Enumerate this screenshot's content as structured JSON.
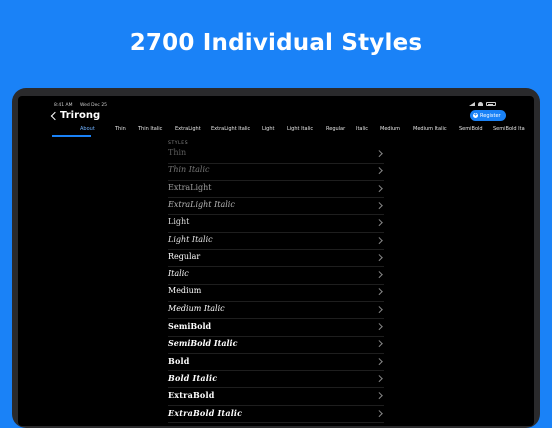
{
  "headline": "2700 Individual Styles",
  "status": {
    "time": "8:41 AM",
    "date": "Wed Dec 25"
  },
  "nav": {
    "title": "Trirong"
  },
  "register": {
    "label": "Register"
  },
  "tabs": [
    "About",
    "Thin",
    "Thin Italic",
    "ExtraLight",
    "ExtraLight Italic",
    "Light",
    "Light Italic",
    "Regular",
    "Italic",
    "Medium",
    "Medium Italic",
    "SemiBold",
    "SemiBold Ita"
  ],
  "section_label": "STYLES",
  "styles": [
    "Thin",
    "Thin Italic",
    "ExtraLight",
    "ExtraLight Italic",
    "Light",
    "Light Italic",
    "Regular",
    "Italic",
    "Medium",
    "Medium Italic",
    "SemiBold",
    "SemiBold Italic",
    "Bold",
    "Bold Italic",
    "ExtraBold",
    "ExtraBold Italic"
  ],
  "colors": {
    "background": "#1a82f7",
    "accent": "#1a82f7",
    "screen": "#000000"
  }
}
